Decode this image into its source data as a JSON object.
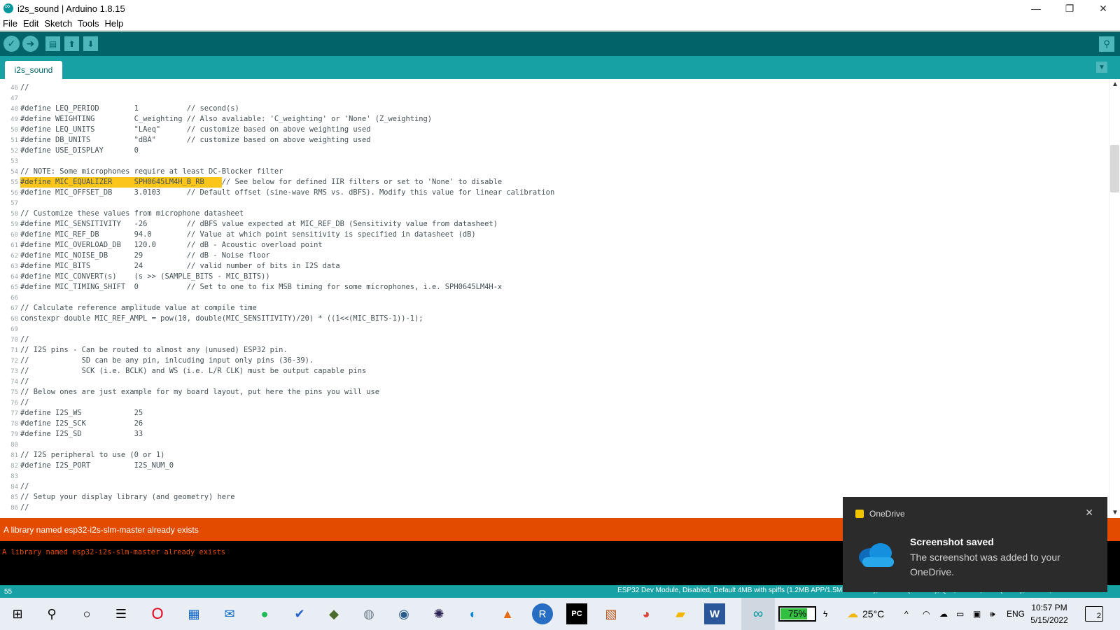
{
  "window": {
    "title": "i2s_sound | Arduino 1.8.15",
    "minimize": "—",
    "restore": "❐",
    "close": "✕"
  },
  "menu": [
    "File",
    "Edit",
    "Sketch",
    "Tools",
    "Help"
  ],
  "toolbar": {
    "verify_icon": "check-icon",
    "upload_icon": "arrow-right-icon",
    "new_icon": "new-file-icon",
    "open_icon": "arrow-up-icon",
    "save_icon": "arrow-down-icon",
    "serial_icon": "magnifier-icon"
  },
  "tab": {
    "label": "i2s_sound",
    "menu_icon": "▼"
  },
  "editor": {
    "highlight_line": "55",
    "lines": [
      {
        "n": "46",
        "t": "//"
      },
      {
        "n": "47",
        "t": ""
      },
      {
        "n": "48",
        "t": "#define LEQ_PERIOD        1           // second(s)"
      },
      {
        "n": "49",
        "t": "#define WEIGHTING         C_weighting // Also avaliable: 'C_weighting' or 'None' (Z_weighting)"
      },
      {
        "n": "50",
        "t": "#define LEQ_UNITS         \"LAeq\"      // customize based on above weighting used"
      },
      {
        "n": "51",
        "t": "#define DB_UNITS          \"dBA\"       // customize based on above weighting used"
      },
      {
        "n": "52",
        "t": "#define USE_DISPLAY       0"
      },
      {
        "n": "53",
        "t": ""
      },
      {
        "n": "54",
        "t": "// NOTE: Some microphones require at least DC-Blocker filter"
      },
      {
        "n": "55",
        "t": "#define MIC_EQUALIZER     SPH0645LM4H_B_RB    // See below for defined IIR filters or set to 'None' to disable",
        "hl": "#define MIC_EQUALIZER     SPH0645LM4H_B_RB    ",
        "rest": "// See below for defined IIR filters or set to 'None' to disable"
      },
      {
        "n": "56",
        "t": "#define MIC_OFFSET_DB     3.0103      // Default offset (sine-wave RMS vs. dBFS). Modify this value for linear calibration"
      },
      {
        "n": "57",
        "t": ""
      },
      {
        "n": "58",
        "t": "// Customize these values from microphone datasheet"
      },
      {
        "n": "59",
        "t": "#define MIC_SENSITIVITY   -26         // dBFS value expected at MIC_REF_DB (Sensitivity value from datasheet)"
      },
      {
        "n": "60",
        "t": "#define MIC_REF_DB        94.0        // Value at which point sensitivity is specified in datasheet (dB)"
      },
      {
        "n": "61",
        "t": "#define MIC_OVERLOAD_DB   120.0       // dB - Acoustic overload point"
      },
      {
        "n": "62",
        "t": "#define MIC_NOISE_DB      29          // dB - Noise floor"
      },
      {
        "n": "63",
        "t": "#define MIC_BITS          24          // valid number of bits in I2S data"
      },
      {
        "n": "64",
        "t": "#define MIC_CONVERT(s)    (s >> (SAMPLE_BITS - MIC_BITS))"
      },
      {
        "n": "65",
        "t": "#define MIC_TIMING_SHIFT  0           // Set to one to fix MSB timing for some microphones, i.e. SPH0645LM4H-x"
      },
      {
        "n": "66",
        "t": ""
      },
      {
        "n": "67",
        "t": "// Calculate reference amplitude value at compile time"
      },
      {
        "n": "68",
        "t": "constexpr double MIC_REF_AMPL = pow(10, double(MIC_SENSITIVITY)/20) * ((1<<(MIC_BITS-1))-1);"
      },
      {
        "n": "69",
        "t": ""
      },
      {
        "n": "70",
        "t": "//"
      },
      {
        "n": "71",
        "t": "// I2S pins - Can be routed to almost any (unused) ESP32 pin."
      },
      {
        "n": "72",
        "t": "//            SD can be any pin, inlcuding input only pins (36-39)."
      },
      {
        "n": "73",
        "t": "//            SCK (i.e. BCLK) and WS (i.e. L/R CLK) must be output capable pins"
      },
      {
        "n": "74",
        "t": "//"
      },
      {
        "n": "75",
        "t": "// Below ones are just example for my board layout, put here the pins you will use"
      },
      {
        "n": "76",
        "t": "//"
      },
      {
        "n": "77",
        "t": "#define I2S_WS            25"
      },
      {
        "n": "78",
        "t": "#define I2S_SCK           26"
      },
      {
        "n": "79",
        "t": "#define I2S_SD            33"
      },
      {
        "n": "80",
        "t": ""
      },
      {
        "n": "81",
        "t": "// I2S peripheral to use (0 or 1)"
      },
      {
        "n": "82",
        "t": "#define I2S_PORT          I2S_NUM_0"
      },
      {
        "n": "83",
        "t": ""
      },
      {
        "n": "84",
        "t": "//"
      },
      {
        "n": "85",
        "t": "// Setup your display library (and geometry) here"
      },
      {
        "n": "86",
        "t": "//"
      }
    ]
  },
  "status": {
    "message": "A library named esp32-i2s-slm-master already exists",
    "console": "A library named esp32-i2s-slm-master already exists",
    "line_number": "55",
    "board": "ESP32 Dev Module, Disabled, Default 4MB with spiffs (1.2MB APP/1.5MB SPIFFS), 240MHz (WiFi/BT), QIO, 80MHz, 4MB (32Mb), 921600, None on COM16"
  },
  "toast": {
    "app": "OneDrive",
    "title": "Screenshot saved",
    "body": "The screenshot was added to your OneDrive.",
    "close": "✕"
  },
  "taskbar": {
    "apps": [
      "windows-start-icon",
      "search-icon",
      "cortana-icon",
      "task-view-icon",
      "opera-icon",
      "microsoft-store-icon",
      "mail-icon",
      "spotify-icon",
      "todo-icon",
      "game-icon",
      "app-icon",
      "app-icon",
      "eclipse-icon",
      "edge-icon",
      "matlab-icon",
      "r-icon",
      "pycharm-icon",
      "office-icon",
      "chrome-icon",
      "file-explorer-icon",
      "word-icon",
      "arduino-icon"
    ],
    "battery": "75%",
    "weather": "25°C",
    "language": "ENG",
    "time": "10:57 PM",
    "date": "5/15/2022",
    "notifications": "2"
  },
  "colors": {
    "toolbar": "#006468",
    "tabbar": "#17a1a5",
    "error": "#e34c00",
    "highlight": "#fcc519"
  }
}
